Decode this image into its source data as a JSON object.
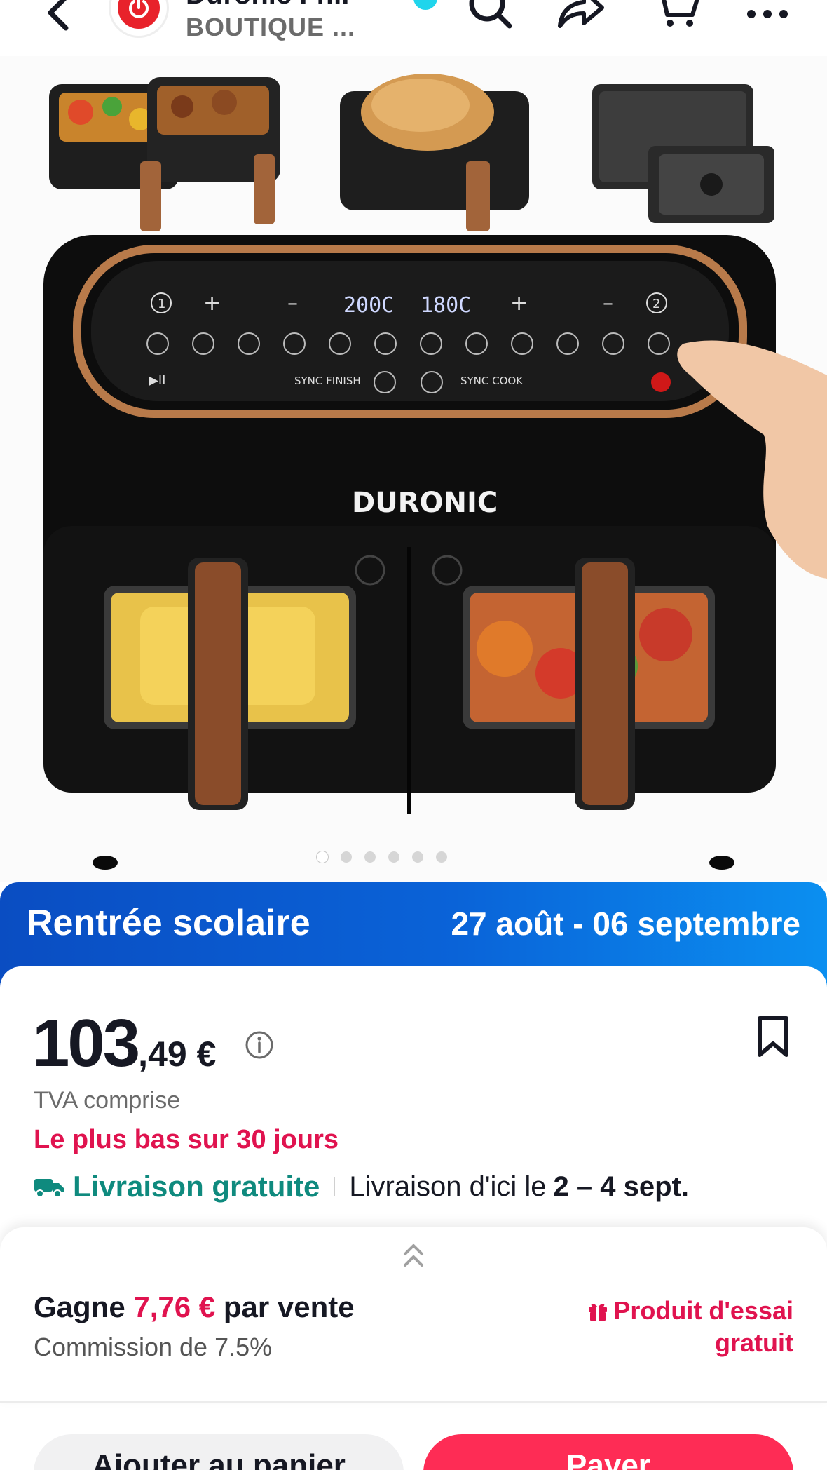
{
  "header": {
    "shop_name": "Duronic Fr...",
    "shop_subtitle": "BOUTIQUE ...",
    "icons": [
      "back-icon",
      "search-icon",
      "share-icon",
      "cart-icon",
      "more-icon"
    ]
  },
  "gallery": {
    "brand_label": "DURONIC",
    "panel_left_temp": "200C",
    "panel_right_temp": "180C",
    "sync_finish": "SYNC FINISH",
    "sync_cook": "SYNC COOK",
    "slide_count": 6,
    "active_slide": 1
  },
  "promo": {
    "title": "Rentrée scolaire",
    "dates": "27 août - 06 septembre"
  },
  "price": {
    "integer": "103",
    "decimal": ",49 €",
    "tax_note": "TVA comprise",
    "lowest_note": "Le plus bas sur 30 jours"
  },
  "delivery": {
    "free_label": "Livraison gratuite",
    "text": "Livraison d'ici le",
    "dates": "2 – 4 sept."
  },
  "affiliate": {
    "earn_prefix": "Gagne",
    "earn_amount": "7,76 €",
    "earn_suffix": "par vente",
    "commission": "Commission de 7.5%",
    "trial_label": "Produit d'essai gratuit"
  },
  "actions": {
    "secondary_label": "Ajouter au panier",
    "primary_label": "Payer"
  },
  "colors": {
    "accent": "#fe2c55",
    "price_red": "#e0134f",
    "shipping_teal": "#0f8a7e",
    "promo_blue": "#0a63d8"
  }
}
